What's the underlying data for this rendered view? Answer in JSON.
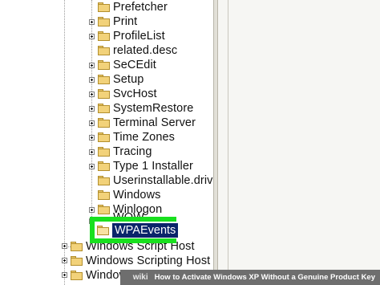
{
  "tree": {
    "items": [
      {
        "label": "Prefetcher",
        "expander": false
      },
      {
        "label": "Print",
        "expander": true
      },
      {
        "label": "ProfileList",
        "expander": true
      },
      {
        "label": "related.desc",
        "expander": false
      },
      {
        "label": "SeCEdit",
        "expander": true
      },
      {
        "label": "Setup",
        "expander": true
      },
      {
        "label": "SvcHost",
        "expander": true
      },
      {
        "label": "SystemRestore",
        "expander": true
      },
      {
        "label": "Terminal Server",
        "expander": true
      },
      {
        "label": "Time Zones",
        "expander": true
      },
      {
        "label": "Tracing",
        "expander": true
      },
      {
        "label": "Type 1 Installer",
        "expander": true
      },
      {
        "label": "Userinstallable.drivers",
        "expander": false
      },
      {
        "label": "Windows",
        "expander": false
      },
      {
        "label": "Winlogon",
        "expander": true
      },
      {
        "label": "WOW",
        "expander": true
      }
    ],
    "selected": {
      "label": "WPAEvents"
    },
    "lower_items": [
      {
        "label": "Windows Script Host",
        "expander": true
      },
      {
        "label": "Windows Scripting Host",
        "expander": true
      },
      {
        "label": "Windows Search",
        "expander": true
      }
    ]
  },
  "colors": {
    "highlight_outline": "#19e01f",
    "selection_bg": "#0a246a",
    "folder": "#f2d27a"
  },
  "caption": {
    "site": "wiki",
    "text": "How to Activate Windows XP Without a Genuine Product Key"
  }
}
